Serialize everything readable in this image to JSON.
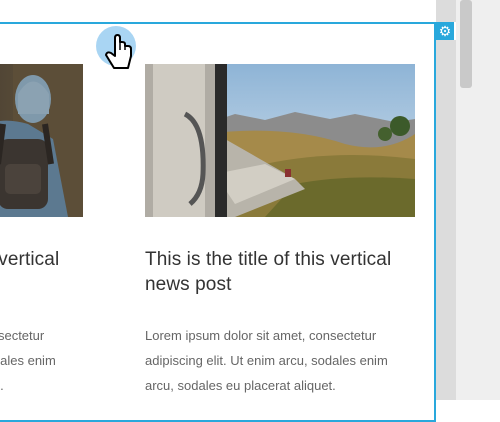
{
  "cards": [
    {
      "title": "This is the title of this vertical news post",
      "excerpt": "Lorem ipsum dolor sit amet, consectetur adipiscing elit. Ut enim arcu, sodales enim arcu, sodales eu placerat aliquet.",
      "image": "hiker-backpack-photo"
    },
    {
      "title": "This is the title of this vertical news post",
      "excerpt": "Lorem ipsum dolor sit amet, consectetur adipiscing elit. Ut enim arcu, sodales enim arcu, sodales eu placerat aliquet.",
      "image": "train-landscape-photo"
    }
  ],
  "settings_icon": "gear-icon",
  "cursor_icon": "hand-pointer-icon",
  "colors": {
    "accent": "#29a8dc",
    "title": "#333333",
    "text": "#666666"
  }
}
